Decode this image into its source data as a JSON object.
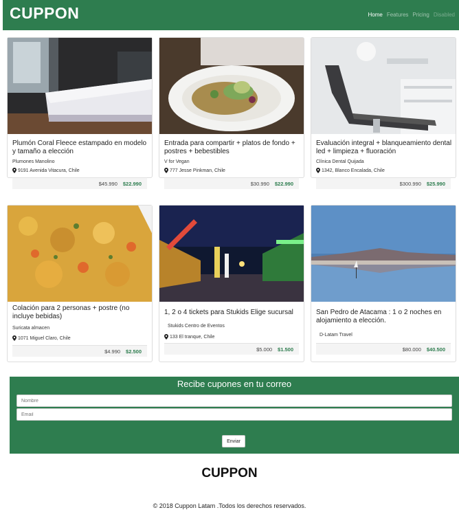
{
  "brand": "CUPPON",
  "nav": [
    {
      "label": "Home"
    },
    {
      "label": "Features"
    },
    {
      "label": "Pricing"
    },
    {
      "label": "Disabled"
    }
  ],
  "deals": [
    {
      "title": "Plumón Coral Fleece estampado en modelo y tamaño a elección",
      "vendor": "Plumones Manolino",
      "address": "9191 Avenida Vitacura, Chile",
      "old_price": "$45.990",
      "new_price": "$22.990"
    },
    {
      "title": "Entrada para compartir + platos de fondo + postres + bebestibles",
      "vendor": "V for Vegan",
      "address": "777 Jesse Pinkman, Chile",
      "old_price": "$30.990",
      "new_price": "$22.990"
    },
    {
      "title": "Evaluación integral + blanqueamiento dental led + limpieza + fluoración",
      "vendor": "Clínica Dental Quijada",
      "address": "1342, Blanco Encalada, Chile",
      "old_price": "$300.990",
      "new_price": "$25.990"
    },
    {
      "title": "Colación para 2 personas + postre (no incluye bebidas)",
      "vendor": "Suricata almacen",
      "address": "1071 Miguel Claro, Chile",
      "old_price": "$4.990",
      "new_price": "$2.500"
    },
    {
      "title": "1, 2 o 4 tickets para Stukids Elige sucursal",
      "vendor": "Stukids Centro de Eventos",
      "address": "133 El tranque, Chile",
      "old_price": "$5.000",
      "new_price": "$1.500"
    },
    {
      "title": "San Pedro de Atacama : 1 o 2 noches en alojamiento a elección.",
      "vendor": "D-Latam Travel",
      "address": "",
      "old_price": "$80.000",
      "new_price": "$40.500"
    }
  ],
  "newsletter": {
    "title": "Recibe cupones en tu correo",
    "name_placeholder": "Nombre",
    "email_placeholder": "Email",
    "submit_label": "Enviar"
  },
  "footer": {
    "brand": "CUPPON",
    "copyright": "© 2018 Cuppon Latam .Todos los derechos reservados."
  },
  "colors": {
    "accent": "#2e7d4f"
  },
  "icons": {
    "address": "map-marker-icon"
  }
}
